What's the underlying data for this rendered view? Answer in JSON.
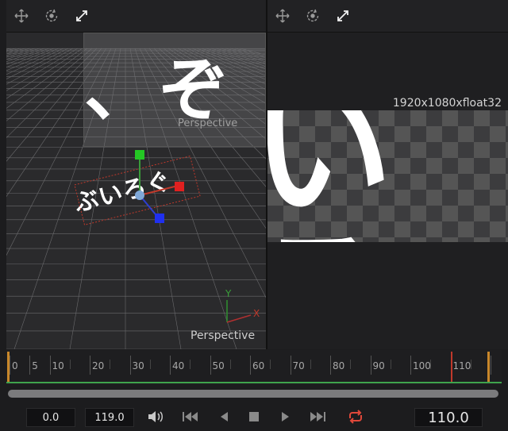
{
  "left_viewer": {
    "toolbar": [
      "move-icon",
      "rotate-icon",
      "scale-icon"
    ],
    "scene_text": "ぶいろぐ",
    "large_text_fragment": "、ぞ",
    "main_label": "Perspective",
    "ghost_label": "Perspective",
    "axis_y": "Y",
    "axis_x": "X"
  },
  "right_viewer": {
    "toolbar": [
      "move-icon",
      "rotate-icon",
      "scale-icon"
    ],
    "resolution": "1920x1080xfloat32",
    "text_fragment": "いろ"
  },
  "timeline": {
    "labels": [
      "0",
      "5",
      "10",
      "20",
      "30",
      "40",
      "50",
      "60",
      "70",
      "80",
      "90",
      "100",
      "110"
    ],
    "render_start": 0,
    "render_end": 119,
    "current_frame": 110,
    "colors": {
      "in_out": "#c8872a",
      "playhead": "#c0392b",
      "range": "#3fa34d"
    }
  },
  "transport": {
    "start": "0.0",
    "end": "119.0",
    "current": "110.0",
    "buttons": [
      "audio-icon",
      "go-to-start-icon",
      "play-reverse-icon",
      "stop-icon",
      "play-icon",
      "go-to-end-icon",
      "loop-icon"
    ],
    "loop_color": "#e0483a"
  }
}
